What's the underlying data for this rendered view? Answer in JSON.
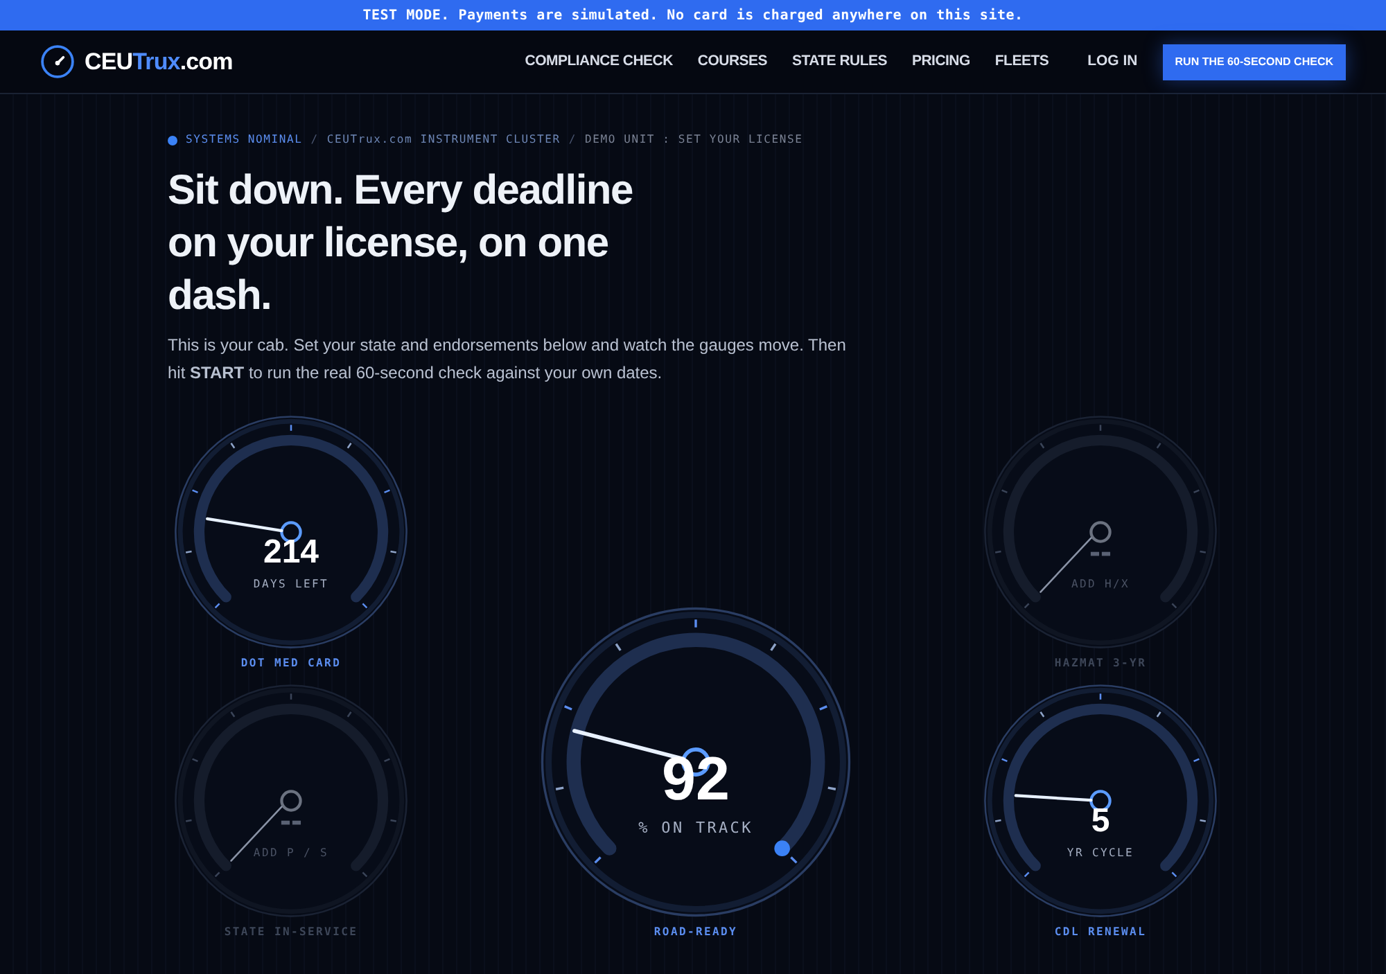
{
  "banner": {
    "text": "TEST MODE. Payments are simulated. No card is charged anywhere on this site."
  },
  "logo": {
    "parts": [
      {
        "text": "CEU",
        "accent": false
      },
      {
        "text": "Trux",
        "accent": true
      },
      {
        "text": ".com",
        "accent": false
      }
    ]
  },
  "nav": {
    "links": [
      "COMPLIANCE CHECK",
      "COURSES",
      "STATE RULES",
      "PRICING",
      "FLEETS"
    ],
    "login": "LOG IN",
    "cta": "RUN THE 60-SECOND CHECK"
  },
  "breadcrumb": {
    "separator": "/",
    "items": [
      "SYSTEMS NOMINAL",
      "CEUTrux.com INSTRUMENT CLUSTER",
      "DEMO UNIT : SET YOUR LICENSE"
    ]
  },
  "headline": "Sit down. Every deadline on your license, on one dash.",
  "intro": "This is your cab. Set your state and endorsements below and watch the gauges move. Then hit **START** to run the real 60-second check against your own dates.",
  "clusters": {
    "left": [
      {
        "kind": "small",
        "active": true,
        "value": "214",
        "unit": "DAYS LEFT",
        "label": "DOT MED CARD",
        "level": 0.2
      },
      {
        "kind": "small",
        "active": false,
        "value": "--",
        "unit": "ADD P / S",
        "label": "STATE IN-SERVICE"
      }
    ],
    "center": [
      {
        "kind": "large",
        "active": true,
        "value": "92",
        "unit": "% ON TRACK",
        "label": "ROAD-READY",
        "level": 0.22
      }
    ],
    "right": [
      {
        "kind": "small",
        "active": false,
        "value": "--",
        "unit": "ADD H/X",
        "label": "HAZMAT 3-YR"
      },
      {
        "kind": "small",
        "active": true,
        "value": "5",
        "unit": "YR CYCLE",
        "label": "CDL RENEWAL",
        "level": 0.18
      }
    ]
  }
}
